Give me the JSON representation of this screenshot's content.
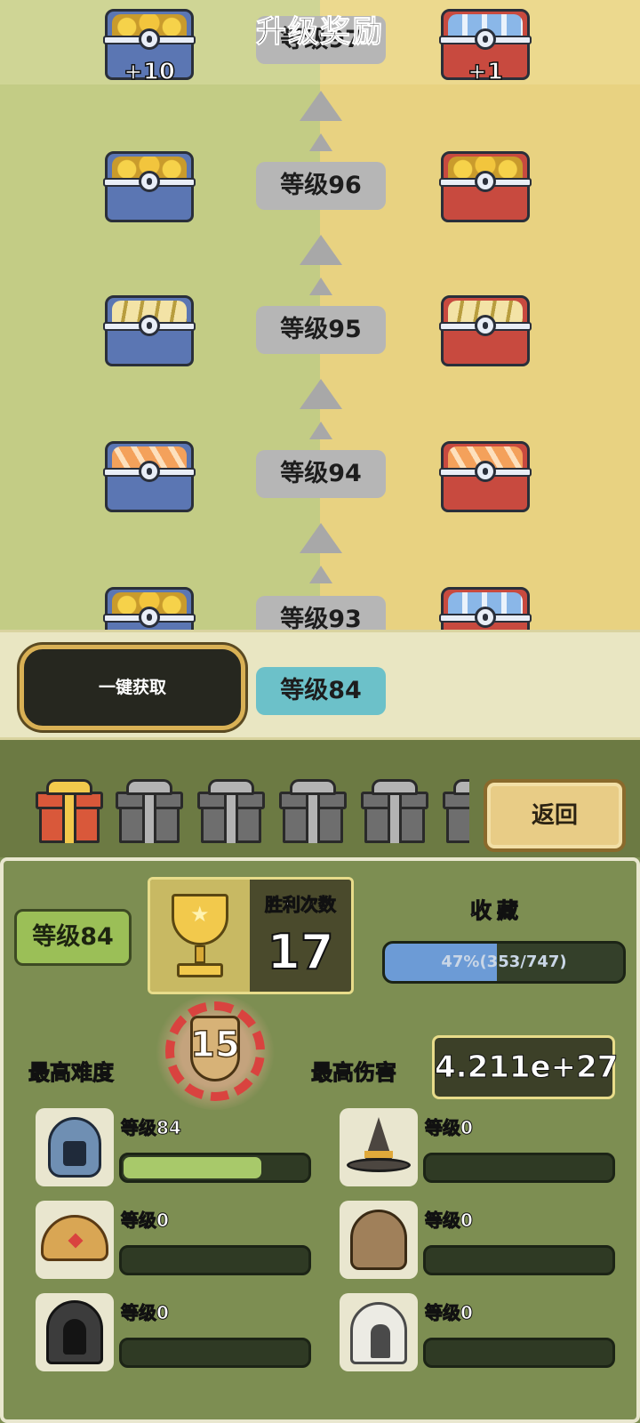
{
  "track": {
    "title": "升级奖励",
    "rows": [
      {
        "level_label": "等级97",
        "left_loot": "gold",
        "right_loot": "ticket",
        "left_count": "+10",
        "right_count": "+1"
      },
      {
        "level_label": "等级96",
        "left_loot": "gold",
        "right_loot": "gold"
      },
      {
        "level_label": "等级95",
        "left_loot": "cards",
        "right_loot": "cards"
      },
      {
        "level_label": "等级94",
        "left_loot": "orange",
        "right_loot": "orange"
      },
      {
        "level_label": "等级93",
        "left_loot": "gold",
        "right_loot": "ticket"
      }
    ]
  },
  "claim": {
    "button_label": "一键获取",
    "current_level_label": "等级84"
  },
  "gifts": {
    "items": [
      "gold",
      "grey",
      "grey",
      "grey",
      "grey",
      "grey"
    ],
    "back_label": "返回"
  },
  "stats": {
    "level_label": "等级84",
    "wins_label": "胜利次数",
    "wins_value": "17",
    "collection_label": "收藏",
    "collection_text": "47%(353/747)",
    "collection_fraction": 0.47,
    "max_difficulty_label": "最高难度",
    "max_difficulty_value": "15",
    "max_damage_label": "最高伤害",
    "max_damage_value": "4.211e+27"
  },
  "heroes": [
    {
      "icon": "knight-helmet-icon",
      "level_label": "等级84",
      "progress": 0.74
    },
    {
      "icon": "wizard-hat-icon",
      "level_label": "等级0",
      "progress": 0
    },
    {
      "icon": "crown-turban-icon",
      "level_label": "等级0",
      "progress": 0
    },
    {
      "icon": "leather-hood-icon",
      "level_label": "等级0",
      "progress": 0
    },
    {
      "icon": "dark-hood-icon",
      "level_label": "等级0",
      "progress": 0
    },
    {
      "icon": "leaf-hood-icon",
      "level_label": "等级0",
      "progress": 0
    }
  ],
  "colors": {
    "accent_teal": "#6cc1c9",
    "progress_green": "#a8c96a",
    "collection_blue": "#6c9bd6"
  }
}
